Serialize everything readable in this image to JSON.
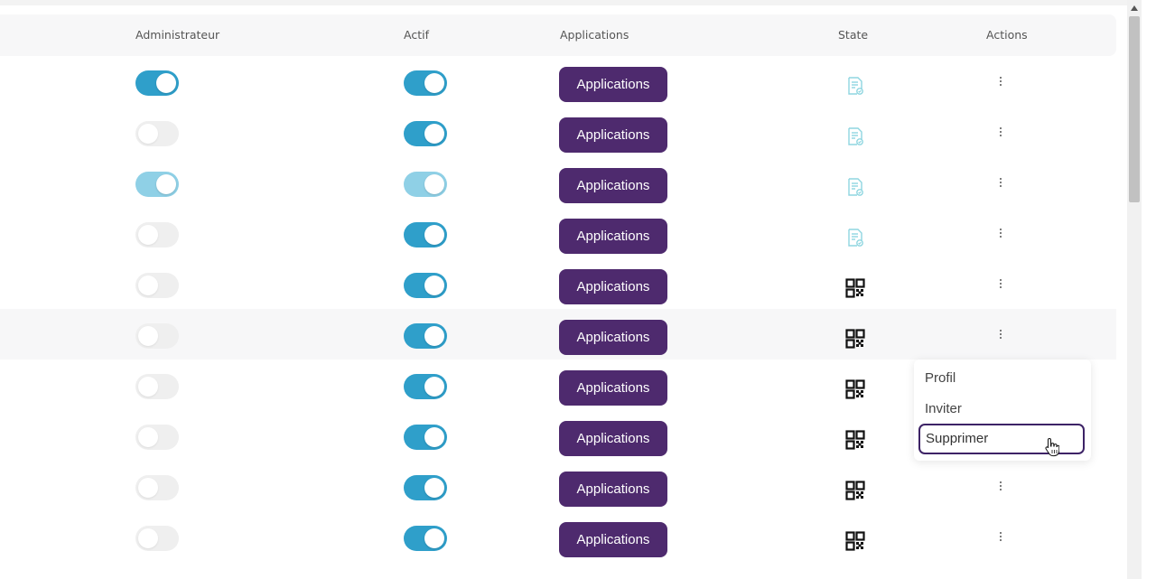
{
  "table": {
    "headers": {
      "admin": "Administrateur",
      "actif": "Actif",
      "applications": "Applications",
      "state": "State",
      "actions": "Actions"
    },
    "rows": [
      {
        "admin": "on",
        "actif": "on",
        "app_label": "Applications",
        "state_icon": "document-check-icon"
      },
      {
        "admin": "off",
        "actif": "on",
        "app_label": "Applications",
        "state_icon": "document-check-icon"
      },
      {
        "admin": "on-light",
        "actif": "on-light",
        "app_label": "Applications",
        "state_icon": "document-check-icon"
      },
      {
        "admin": "off",
        "actif": "on",
        "app_label": "Applications",
        "state_icon": "document-check-icon"
      },
      {
        "admin": "off",
        "actif": "on",
        "app_label": "Applications",
        "state_icon": "qr-code-icon"
      },
      {
        "admin": "off",
        "actif": "on",
        "app_label": "Applications",
        "state_icon": "qr-code-icon"
      },
      {
        "admin": "off",
        "actif": "on",
        "app_label": "Applications",
        "state_icon": "qr-code-icon"
      },
      {
        "admin": "off",
        "actif": "on",
        "app_label": "Applications",
        "state_icon": "qr-code-icon"
      },
      {
        "admin": "off",
        "actif": "on",
        "app_label": "Applications",
        "state_icon": "qr-code-icon"
      },
      {
        "admin": "off",
        "actif": "on",
        "app_label": "Applications",
        "state_icon": "qr-code-icon"
      }
    ]
  },
  "actions_menu": {
    "items": [
      "Profil",
      "Inviter",
      "Supprimer"
    ],
    "highlighted": "Supprimer"
  },
  "colors": {
    "toggle_on": "#2f9fca",
    "toggle_on_light": "#8fd0e6",
    "toggle_off": "#efefef",
    "app_button": "#4e2a6e",
    "state_doc_icon": "#8fd6e0",
    "state_qr_icon": "#111111"
  },
  "icons": {
    "row_actions": "more-vertical-icon",
    "cursor": "hand-pointer-icon"
  }
}
